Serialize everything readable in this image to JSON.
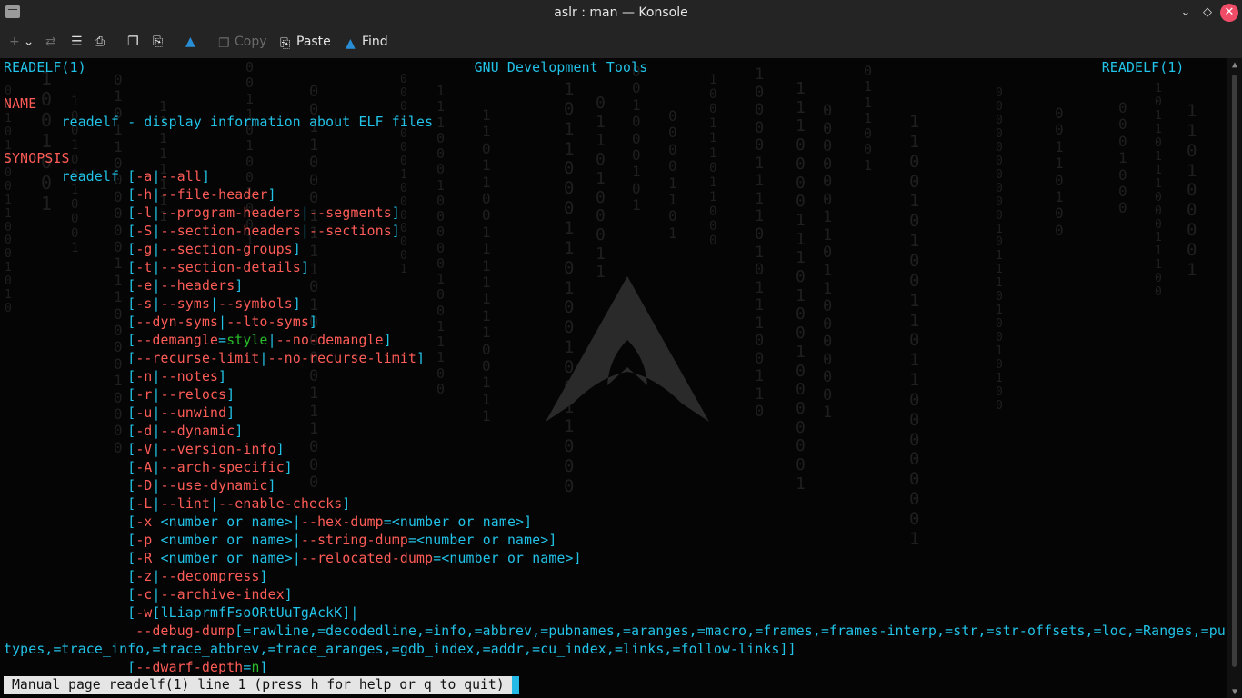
{
  "window": {
    "title": "aslr : man — Konsole",
    "close_icon": "close-icon",
    "maximize_icon": "maximize-icon",
    "minimize_icon": "minimize-icon"
  },
  "toolbar": {
    "copy_label": "Copy",
    "paste_label": "Paste",
    "find_label": "Find"
  },
  "man": {
    "header_left": "READELF(1)",
    "header_center": "GNU Development Tools",
    "header_right": "READELF(1)",
    "name_heading": "NAME",
    "name_line": "readelf - display information about ELF files",
    "synopsis_heading": "SYNOPSIS",
    "command": "readelf"
  },
  "status": {
    "text": "Manual page readelf(1) line 1 (press h for help or q to quit)"
  },
  "colors": {
    "heading": "#ff5c57",
    "option": "#22c3e8",
    "arg": "#2bbd2b",
    "cursor": "#25b9e8"
  }
}
